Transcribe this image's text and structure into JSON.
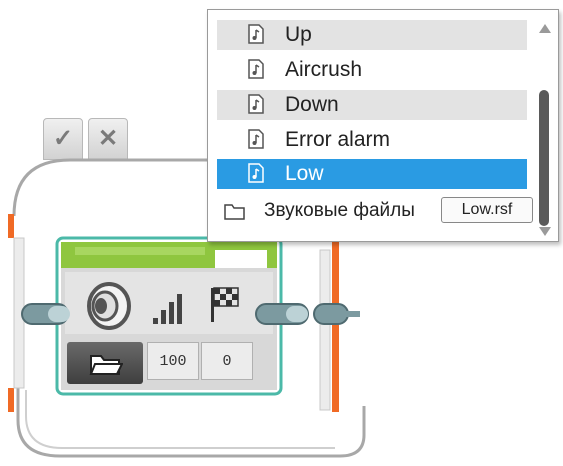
{
  "block": {
    "confirm_symbol": "✓",
    "cancel_symbol": "✕",
    "volume_value": "100",
    "play_type_value": "0"
  },
  "dropdown": {
    "items": [
      {
        "label": "Up",
        "state": "gray"
      },
      {
        "label": "Aircrush",
        "state": "normal"
      },
      {
        "label": "Down",
        "state": "gray"
      },
      {
        "label": "Error alarm",
        "state": "normal"
      },
      {
        "label": "Low",
        "state": "selected"
      }
    ],
    "folder_label": "Звуковые файлы",
    "tooltip": "Low.rsf"
  },
  "colors": {
    "accent_orange": "#f06a25",
    "selection_blue": "#2a9be3",
    "block_green": "#8fc63f",
    "block_teal_border": "#4bb9a8"
  },
  "icons": [
    "music-file-icon",
    "folder-icon",
    "speaker-icon",
    "volume-bars-icon",
    "checkered-flag-icon",
    "scroll-up-icon",
    "scroll-down-icon"
  ]
}
